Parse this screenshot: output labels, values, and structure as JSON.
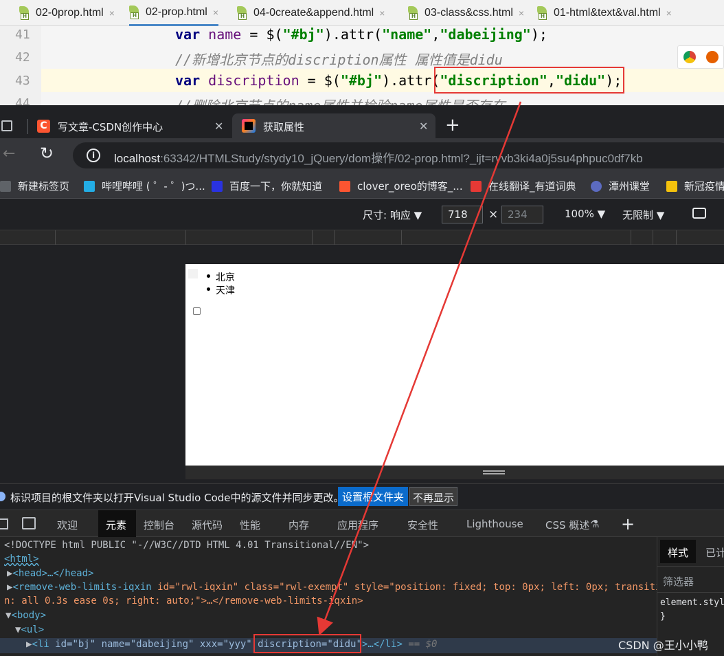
{
  "ide": {
    "tabs": [
      {
        "label": "02-0prop.html",
        "active": false
      },
      {
        "label": "02-prop.html",
        "active": true
      },
      {
        "label": "04-0create&append.html",
        "active": false
      },
      {
        "label": "03-class&css.html",
        "active": false
      },
      {
        "label": "01-html&text&val.html",
        "active": false
      }
    ],
    "close_glyph": "×",
    "lines": [
      {
        "num": "41",
        "kw": "var",
        "name": "name",
        "eq": " = $(",
        "sel": "\"#bj\"",
        "mid": ").attr(",
        "a1": "\"name\"",
        "comma": ",",
        "a2": "\"dabeijing\"",
        "end": ");"
      },
      {
        "num": "42",
        "comment": "//新增北京节点的discription属性 属性值是didu"
      },
      {
        "num": "43",
        "kw": "var",
        "name": "discription",
        "eq": " = $(",
        "sel": "\"#bj\"",
        "mid": ").attr(",
        "a1": "\"discription\"",
        "comma": ",",
        "a2": "\"didu\"",
        "end": ");"
      },
      {
        "num": "44",
        "comment": "//删除北京节点的name属性并检验name属性是否存在"
      }
    ]
  },
  "browser": {
    "tabs": [
      {
        "label": "写文章-CSDN创作中心",
        "icon": "csdn-icon"
      },
      {
        "label": "获取属性",
        "icon": "jetbrains-icon",
        "active": true
      }
    ],
    "new_tab_glyph": "+",
    "close_glyph": "✕",
    "url_host": "localhost",
    "url_rest": ":63342/HTMLStudy/stydy10_jQuery/dom操作/02-prop.html?_ijt=rvvb3ki4a0j5su4phpuc0df7kb",
    "url_right_glyph": "A̅",
    "bookmarks": [
      {
        "label": "新建标签页",
        "color": "#8ab4f8"
      },
      {
        "label": "哔哩哔哩 ( ゜- ゜)つ...",
        "color": "#23ade5"
      },
      {
        "label": "百度一下，你就知道",
        "color": "#2932e1"
      },
      {
        "label": "clover_oreo的博客_...",
        "color": "#fc5531"
      },
      {
        "label": "在线翻译_有道词典",
        "color": "#e53935"
      },
      {
        "label": "潭州课堂",
        "color": "#5c6bc0"
      },
      {
        "label": "新冠疫情",
        "color": "#f4c20d"
      }
    ],
    "devbar": {
      "dimensions_label": "尺寸: 响应",
      "width": "718",
      "times": "×",
      "height": "234",
      "zoom": "100%",
      "throttle": "无限制"
    },
    "page": {
      "items": [
        "北京",
        "天津"
      ]
    },
    "infobar": {
      "message": "标识项目的根文件夹以打开Visual Studio Code中的源文件并同步更改。",
      "set_root_button": "设置根文件夹",
      "dismiss_button": "不再显示"
    },
    "devtools_tabs": [
      "欢迎",
      "元素",
      "控制台",
      "源代码",
      "性能",
      "内存",
      "应用程序",
      "安全性",
      "Lighthouse",
      "CSS 概述",
      "+"
    ],
    "dom_lines": {
      "doctype": "<!DOCTYPE html PUBLIC \"-//W3C//DTD HTML 4.01 Transitional//EN\">",
      "html": "<html>",
      "head": "<head>…</head>",
      "remove_tag": "<remove-web-limits-iqxin",
      "remove_attrs_1": " id=\"rwl-iqxin\" class=\"rwl-exempt\" style=\"position: fixed; top: 0px; left: 0px; transitio",
      "remove_attrs_2": "n: all 0.3s ease 0s; right: auto;\">…</remove-web-limits-iqxin>",
      "body": "<body>",
      "ul": "<ul>",
      "li_open": "<li",
      "li_attrs": " id=\"bj\" name=\"dabeijing\" xxx=\"yyy\" ",
      "li_new_attr": "discription=\"didu\"",
      "li_close": ">…</li>",
      "li_eq": "== $0"
    },
    "styles_pane": {
      "tabs": [
        "样式",
        "已计"
      ],
      "filter": "筛选器",
      "element_style": "element.styl",
      "brace": "}"
    }
  },
  "watermark": "CSDN @王小小鸭"
}
